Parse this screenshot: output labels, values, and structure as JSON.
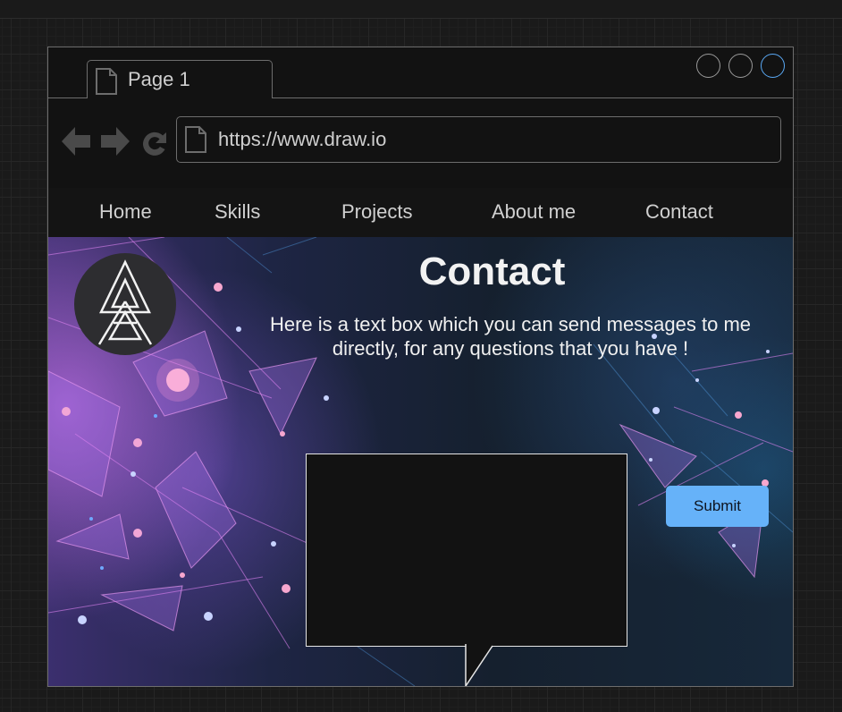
{
  "browser": {
    "tab_label": "Page 1",
    "url": "https://www.draw.io"
  },
  "nav": {
    "items": [
      {
        "label": "Home"
      },
      {
        "label": "Skills"
      },
      {
        "label": "Projects"
      },
      {
        "label": "About me"
      },
      {
        "label": "Contact"
      }
    ]
  },
  "hero": {
    "title": "Contact",
    "description": "Here is a text box which you can send messages to me directly, for any questions that you have !",
    "message_value": "",
    "submit_label": "Submit"
  },
  "colors": {
    "accent": "#66b2f9",
    "frame": "#121212",
    "border": "#6d6d6d"
  },
  "icons": [
    "document-icon",
    "back-arrow-icon",
    "forward-arrow-icon",
    "refresh-icon",
    "logo-icon"
  ]
}
